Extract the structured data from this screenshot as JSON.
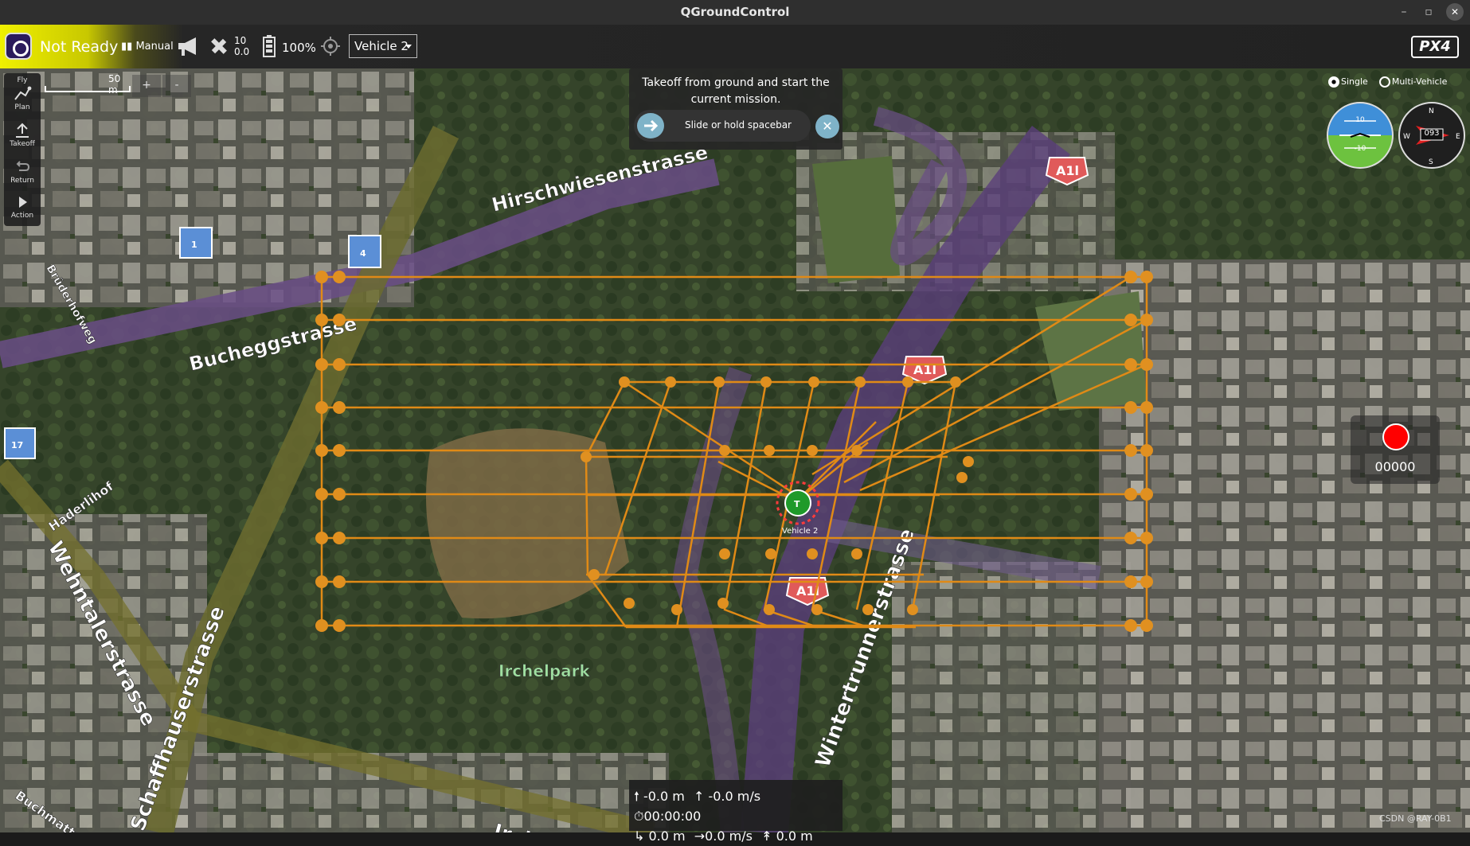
{
  "window": {
    "title": "QGroundControl"
  },
  "toolbar": {
    "status": "Not Ready",
    "flight_mode": "Manual",
    "satellite_count": "10",
    "hdop": "0.0",
    "battery": "100%",
    "vehicle": "Vehicle 2",
    "brand": "PX4"
  },
  "toolstrip": {
    "fly": "Fly",
    "plan": "Plan",
    "takeoff": "Takeoff",
    "return": "Return",
    "action": "Action"
  },
  "map": {
    "scale": "50 m",
    "zoom_in": "+",
    "zoom_out": "-",
    "streets": [
      "Schaffhauserstrasse",
      "Hirschwiesenstrasse",
      "Bucheggstrasse",
      "Brüderhofweg",
      "Wehntalerstrasse",
      "Haderlihof",
      "Irchelpark",
      "Wintertrunnerstrasse",
      "Irchelstrasse",
      "Buchmattweg",
      "A1l"
    ],
    "vehicle_label": "Vehicle 2",
    "markers": [
      "1",
      "4",
      "17"
    ]
  },
  "guided": {
    "message": "Takeoff from ground and start the current mission.",
    "slider_label": "Slide or hold spacebar"
  },
  "instruments": {
    "single_label": "Single",
    "multi_label": "Multi-Vehicle",
    "heading": "093",
    "attitude_top": "10",
    "attitude_bottom": "-10"
  },
  "record": {
    "time": "00000"
  },
  "telemetry": {
    "altitude": "-0.0 m",
    "vertical_speed": "-0.0 m/s",
    "flight_time": "00:00:00",
    "distance_home": "0.0 m",
    "ground_speed": "0.0 m/s",
    "alt_amsl": "0.0 m"
  },
  "watermark": "CSDN @RAY-0B1",
  "colors": {
    "mission_line": "#e08a16",
    "toolbar_ready": "#f0f000"
  }
}
